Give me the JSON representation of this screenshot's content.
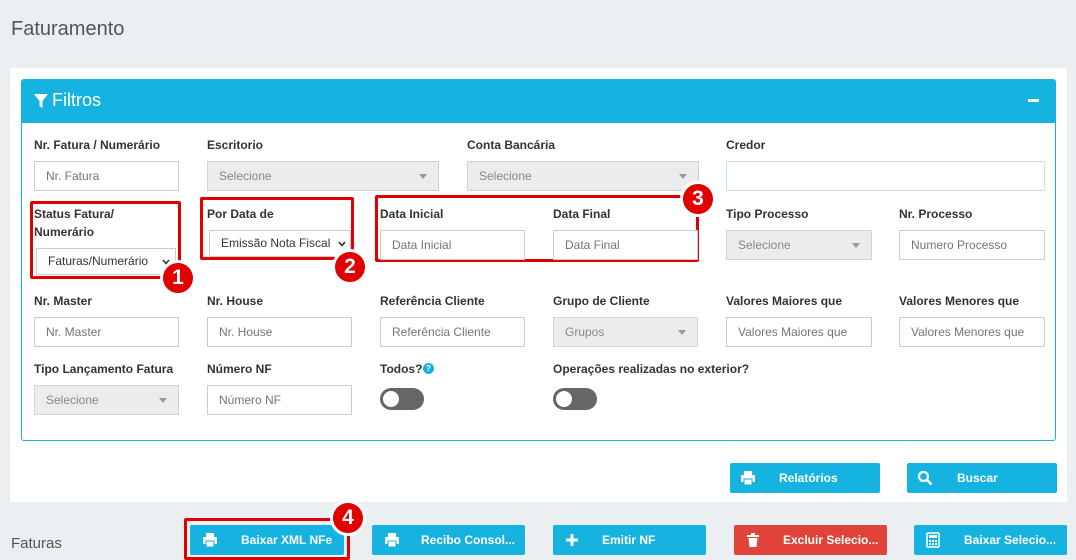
{
  "page": {
    "title": "Faturamento"
  },
  "filters": {
    "title": "Filtros",
    "fields": {
      "nr_fatura": {
        "label": "Nr. Fatura / Numerário",
        "placeholder": "Nr. Fatura"
      },
      "escritorio": {
        "label": "Escritorio",
        "value": "Selecione"
      },
      "conta": {
        "label": "Conta Bancária",
        "value": "Selecione"
      },
      "credor": {
        "label": "Credor",
        "value": ""
      },
      "status": {
        "label1": "Status Fatura/",
        "label2": "Numerário",
        "value": "Faturas/Numerário"
      },
      "por_data": {
        "label": "Por Data de",
        "value": "Emissão Nota Fiscal"
      },
      "data_inicial": {
        "label": "Data Inicial",
        "placeholder": "Data Inicial"
      },
      "data_final": {
        "label": "Data Final",
        "placeholder": "Data Final"
      },
      "tipo_processo": {
        "label": "Tipo Processo",
        "value": "Selecione"
      },
      "nr_processo": {
        "label": "Nr. Processo",
        "placeholder": "Numero Processo"
      },
      "nr_master": {
        "label": "Nr. Master",
        "placeholder": "Nr. Master"
      },
      "nr_house": {
        "label": "Nr. House",
        "placeholder": "Nr. House"
      },
      "ref_cliente": {
        "label": "Referência Cliente",
        "placeholder": "Referência Cliente"
      },
      "grupo": {
        "label": "Grupo de Cliente",
        "value": "Grupos"
      },
      "maiores": {
        "label": "Valores Maiores que",
        "placeholder": "Valores Maiores que"
      },
      "menores": {
        "label": "Valores Menores que",
        "placeholder": "Valores Menores que"
      },
      "tipo_lanc": {
        "label": "Tipo Lançamento Fatura",
        "value": "Selecione"
      },
      "numero_nf": {
        "label": "Número NF",
        "placeholder": "Número NF"
      },
      "todos": {
        "label": "Todos?",
        "help": "?",
        "checked": false
      },
      "exterior": {
        "label": "Operações realizadas no exterior?",
        "checked": false
      }
    },
    "buttons": {
      "relatorios": "Relatórios",
      "buscar": "Buscar"
    }
  },
  "faturas": {
    "title": "Faturas",
    "buttons": {
      "baixar_xml": "Baixar XML NFe",
      "recibo": "Recibo Consol...",
      "emitir": "Emitir NF",
      "excluir": "Excluir Selecio...",
      "baixar_sel": "Baixar Selecio..."
    }
  },
  "callouts": [
    "1",
    "2",
    "3",
    "4"
  ],
  "colors": {
    "accent": "#17b3e0",
    "danger": "#e0433a",
    "highlight": "#e00000"
  }
}
